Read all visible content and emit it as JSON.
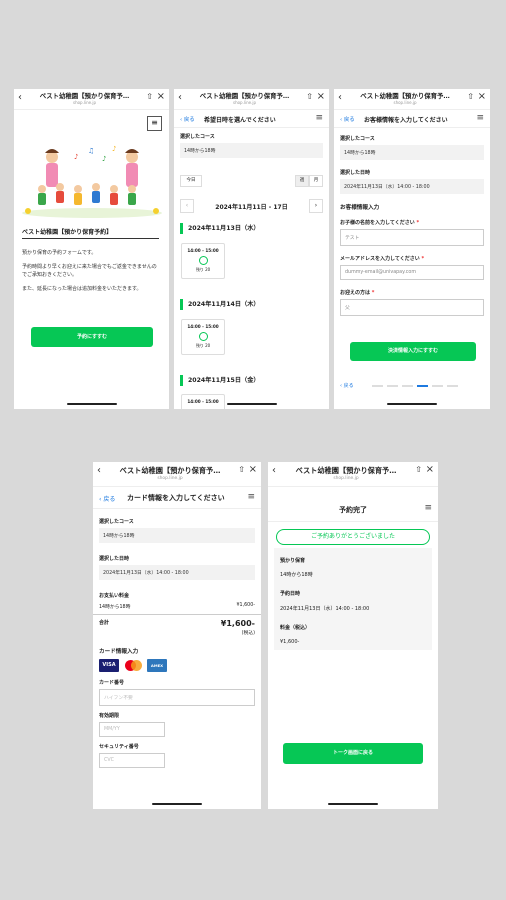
{
  "common": {
    "app_title": "ベスト幼稚園【預かり保育予…",
    "url": "shop.line.jp",
    "back_label": "戻る"
  },
  "screen1": {
    "heading": "ベスト幼稚園【預かり保育予約】",
    "p1": "預かり保育の予約フォームです。",
    "p2": "予約時間より早くお迎えに来た場合でもご返金できませんのでご承知おきください。",
    "p3": "また、延長になった場合は追加料金をいただきます。",
    "button": "予約にすすむ"
  },
  "screen2": {
    "nav_title": "希望日時を選んでください",
    "course_label": "選択したコース",
    "course_value": "14時から18時",
    "today": "今日",
    "seg_week": "週",
    "seg_month": "月",
    "week_range": "2024年11月11日 - 17日",
    "days": [
      {
        "date": "2024年11月13日（水）",
        "slot_time": "14:00 - 15:00",
        "remaining": "残り 20"
      },
      {
        "date": "2024年11月14日（木）",
        "slot_time": "14:00 - 15:00",
        "remaining": "残り 20"
      },
      {
        "date": "2024年11月15日（金）",
        "slot_time": "14:00 - 15:00",
        "remaining": ""
      }
    ]
  },
  "screen3": {
    "nav_title": "お客様情報を入力してください",
    "course_label": "選択したコース",
    "course_value": "14時から18時",
    "date_label": "選択した日時",
    "date_value": "2024年11月13日（水）14:00 - 18:00",
    "section": "お客様情報入力",
    "child_label": "お子様の名前を入力してください",
    "child_value": "テスト",
    "email_label": "メールアドレスを入力してください",
    "email_value": "dummy-email@univapay.com",
    "pickup_label": "お迎えの方は",
    "pickup_value": "父",
    "button": "決済情報入力にすすむ"
  },
  "screen4": {
    "nav_title": "カード情報を入力してください",
    "course_label": "選択したコース",
    "course_value": "14時から18時",
    "date_label": "選択した日時",
    "date_value": "2024年11月13日（水）14:00 - 18:00",
    "fee_label": "お支払い料金",
    "fee_item": "14時から18時",
    "fee_item_price": "¥1,600-",
    "total_label": "合計",
    "total_value": "¥1,600-",
    "tax_note": "(税込)",
    "card_section": "カード情報入力",
    "card_brands": [
      "VISA",
      "Mastercard",
      "AMEX"
    ],
    "card_number_label": "カード番号",
    "card_number_placeholder": "ハイフン不要",
    "expiry_label": "有効期限",
    "expiry_placeholder": "MM/YY",
    "cvc_label": "セキュリティ番号",
    "cvc_placeholder": "CVC"
  },
  "screen5": {
    "nav_title": "予約完了",
    "thanks": "ご予約ありがとうございました",
    "service_label": "預かり保育",
    "service_value": "14時から18時",
    "datetime_label": "予約日時",
    "datetime_value": "2024年11月13日（水）14:00 - 18:00",
    "fee_label": "料金（税込）",
    "fee_value": "¥1,600-",
    "button": "トーク画面に戻る"
  },
  "colors": {
    "accent": "#06c755",
    "link": "#1e7ae0",
    "background": "#d9d9d9"
  }
}
